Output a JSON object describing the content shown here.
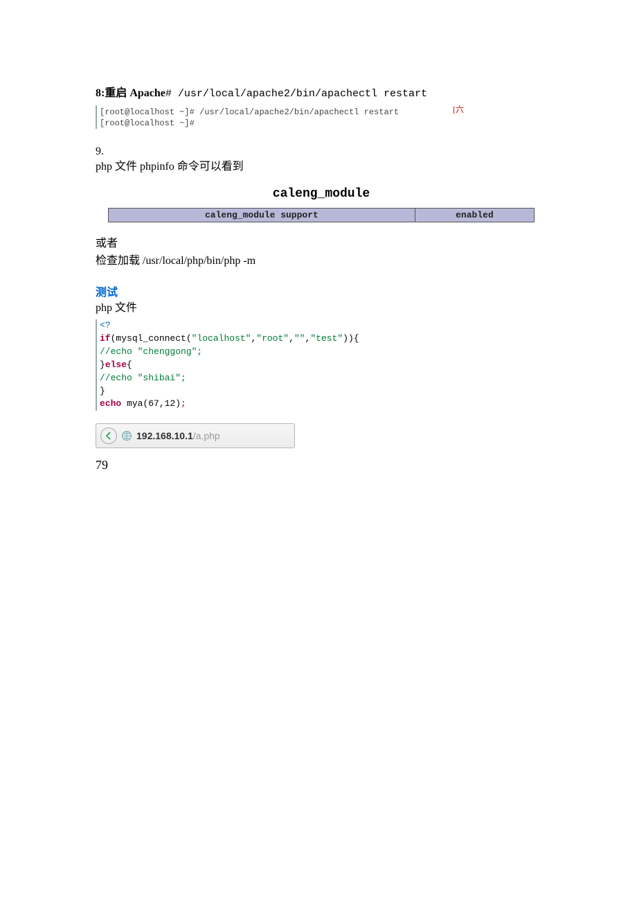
{
  "step8": {
    "label": "8:重启 Apache",
    "cmd_prefix": "# ",
    "cmd": "/usr/local/apache2/bin/apachectl restart"
  },
  "terminal": {
    "annotation": "[六",
    "line1": "[root@localhost ~]# /usr/local/apache2/bin/apachectl restart",
    "line2": "[root@localhost ~]#"
  },
  "step9": {
    "num": "9.",
    "line": "php 文件 phpinfo 命令可以看到"
  },
  "module": {
    "title": "caleng_module",
    "cell_label": "caleng_module support",
    "cell_value": "enabled"
  },
  "or_block": {
    "or": "或者",
    "check": "检查加载 /usr/local/php/bin/php -m"
  },
  "test": {
    "heading": "测试",
    "subtitle": "php 文件"
  },
  "code": {
    "l1_open": "<?",
    "l2_kw": "if",
    "l2_rest_a": "(mysql_connect(",
    "l2_s1": "\"localhost\"",
    "l2_c": ",",
    "l2_s2": "\"root\"",
    "l2_s3": "\"\"",
    "l2_s4": "\"test\"",
    "l2_end": ")){",
    "l3": "//echo \"chenggong\";",
    "l4_a": "}",
    "l4_kw": "else",
    "l4_b": "{",
    "l5": "//echo \"shibai\";",
    "l6": "}",
    "l7_kw": "echo",
    "l7_rest": " mya(67,12)",
    "l7_semi": ";"
  },
  "browser": {
    "host": "192.168.10.1",
    "path": "/a.php"
  },
  "result": "79"
}
